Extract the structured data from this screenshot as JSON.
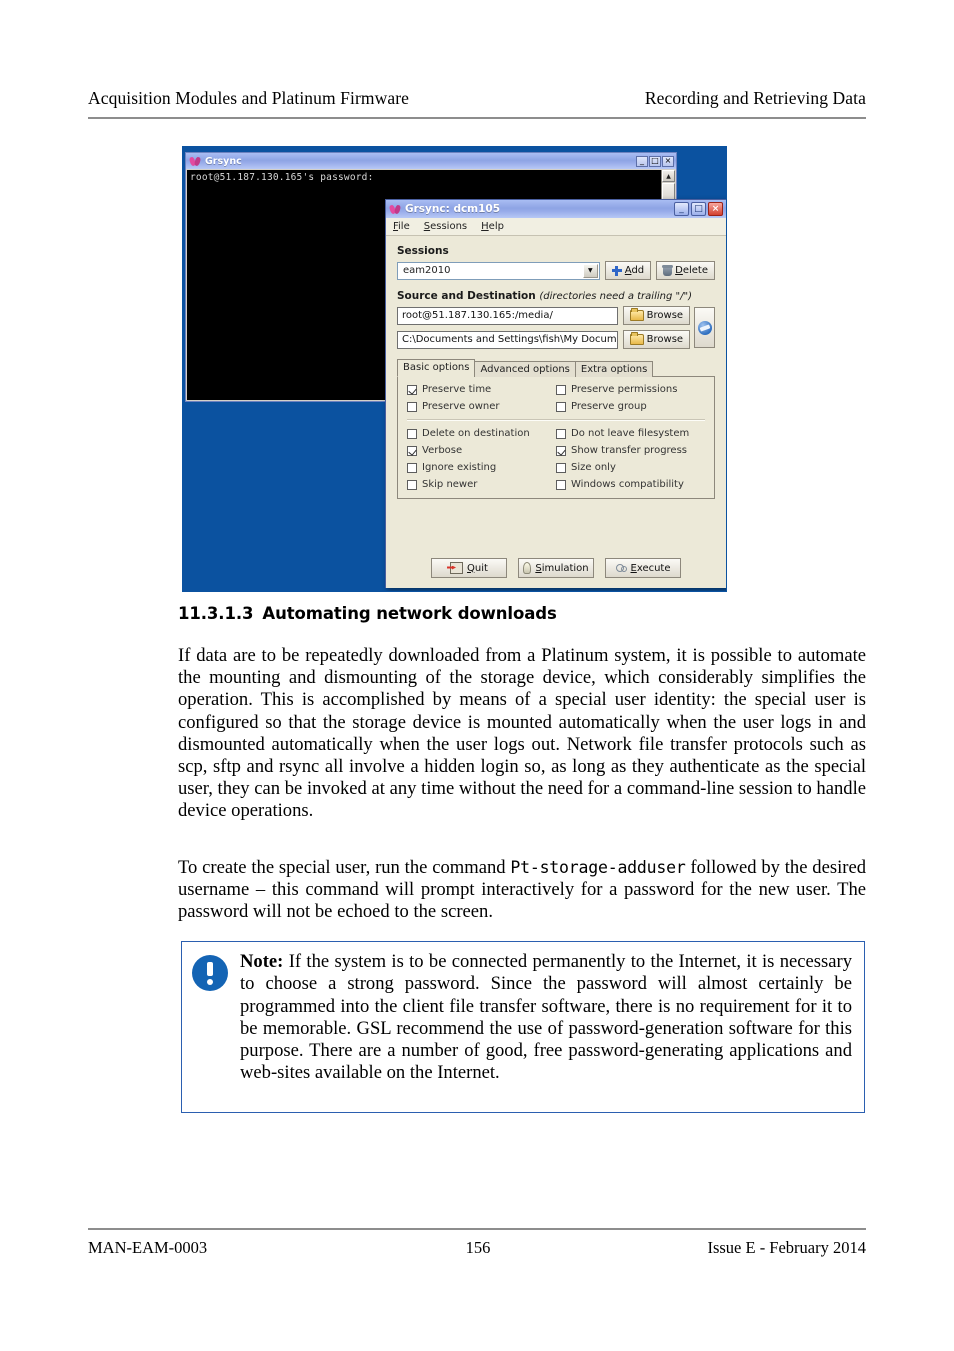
{
  "header": {
    "left": "Acquisition Modules and Platinum Firmware",
    "right": "Recording and Retrieving Data"
  },
  "footer": {
    "doc_number": "MAN-EAM-0003",
    "page_number": "156",
    "issue": "Issue E  - February 2014"
  },
  "screenshot": {
    "terminal_window": {
      "title": "Grsync",
      "console_text": "root@51.187.130.165's password:",
      "minimize_label": "_",
      "maximize_label": "□",
      "close_label": "×",
      "scroll_up_label": "▲"
    },
    "grsync_window": {
      "title": "Grsync: dcm105",
      "minimize_label": "_",
      "maximize_label": "□",
      "close_label": "×",
      "menu": [
        {
          "label": "File",
          "accel": "F",
          "rest": "ile"
        },
        {
          "label": "Sessions",
          "accel": "S",
          "rest": "essions"
        },
        {
          "label": "Help",
          "accel": "H",
          "rest": "elp"
        }
      ],
      "sessions": {
        "group_label": "Sessions",
        "selected": "eam2010",
        "add_label": "Add",
        "add_accel": "A",
        "delete_label": "Delete",
        "delete_accel": "D"
      },
      "source_destination": {
        "group_label": "Source and Destination",
        "group_hint": "(directories need a trailing \"/\")",
        "source_value": "root@51.187.130.165:/media/",
        "destination_value": "C:\\Documents and Settings\\fish\\My Docum",
        "browse_label": "Browse",
        "swap_icon": "swap-arrows-icon"
      },
      "tabs": [
        {
          "label": "Basic options",
          "active": true
        },
        {
          "label": "Advanced options",
          "active": false
        },
        {
          "label": "Extra options",
          "active": false
        }
      ],
      "options_group_1": [
        {
          "label": "Preserve time",
          "checked": true
        },
        {
          "label": "Preserve permissions",
          "checked": false
        },
        {
          "label": "Preserve owner",
          "checked": false
        },
        {
          "label": "Preserve group",
          "checked": false
        }
      ],
      "options_group_2": [
        {
          "label": "Delete on destination",
          "checked": false
        },
        {
          "label": "Do not leave filesystem",
          "checked": false
        },
        {
          "label": "Verbose",
          "checked": true
        },
        {
          "label": "Show transfer progress",
          "checked": true
        },
        {
          "label": "Ignore existing",
          "checked": false
        },
        {
          "label": "Size only",
          "checked": false
        },
        {
          "label": "Skip newer",
          "checked": false
        },
        {
          "label": "Windows compatibility",
          "checked": false
        }
      ],
      "action_buttons": [
        {
          "label": "Quit",
          "accel": "Q",
          "rest": "uit",
          "icon": "exit-door-icon"
        },
        {
          "label": "Simulation",
          "accel": "S",
          "rest": "imulation",
          "icon": "lightbulb-icon"
        },
        {
          "label": "Execute",
          "accel": "E",
          "rest": "xecute",
          "icon": "gears-icon"
        }
      ]
    }
  },
  "section": {
    "number": "11.3.1.3",
    "title": "Automating network downloads"
  },
  "paragraphs": {
    "p1": "If data are to be repeatedly downloaded from a Platinum system, it is possible to automate the mounting and dismounting of the storage device, which considerably simplifies the operation.  This is accomplished by means of a special user identity: the special user is configured so that the storage device is mounted automatically when the user logs in and dismounted automatically when the user logs out.  Network file transfer protocols such as scp, sftp and rsync all involve a hidden login so, as long as they authenticate as the special user, they can be invoked at any time without the need for a command-line session to handle device operations.",
    "p2_before": "To create the special user, run the command ",
    "p2_command": "Pt-storage-adduser",
    "p2_after": " followed by the desired username – this command will prompt interactively for a password for the new user.  The password will not be echoed to the screen."
  },
  "note": {
    "label": "Note:",
    "text": "  If the system is to be connected permanently to the Internet, it is necessary to choose a strong password.  Since the password will almost certainly be programmed into the client file transfer software, there is no requirement for it to be memorable.   GSL recommend the use of password-generation software for this purpose.   There are a number of good, free password-generating applications and web-sites available on the Internet.",
    "icon": "exclamation-circle-icon",
    "border_color": "#2b5fb0",
    "icon_color": "#1464b4"
  }
}
